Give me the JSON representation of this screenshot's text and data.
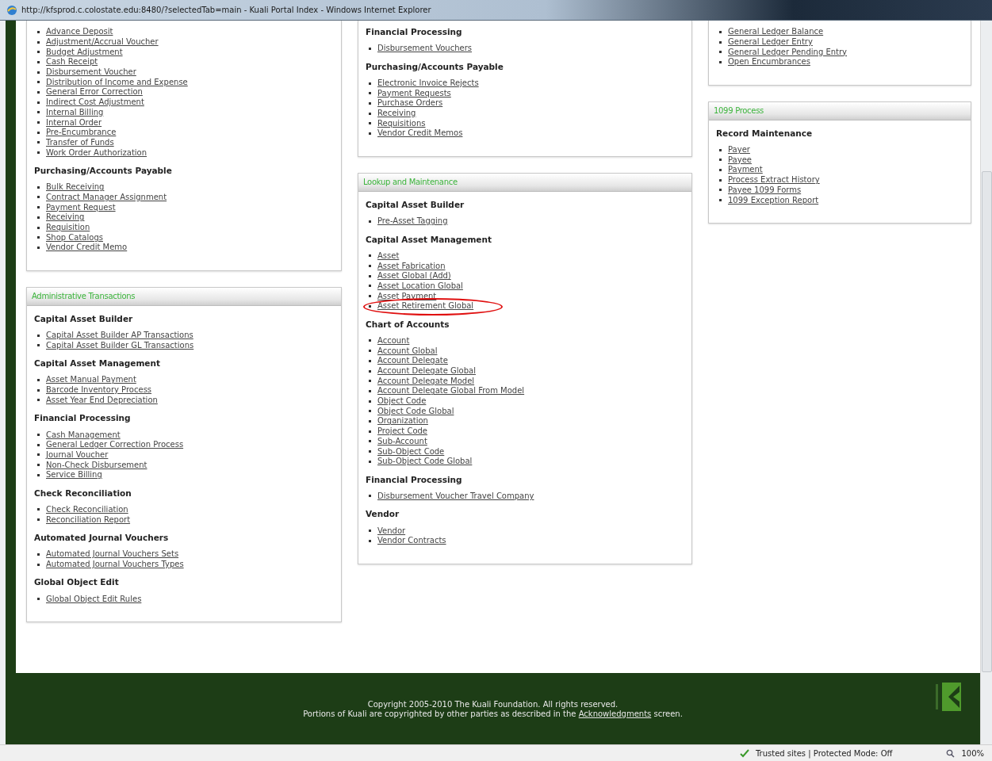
{
  "window": {
    "title": "http://kfsprod.c.colostate.edu:8480/?selectedTab=main - Kuali Portal Index - Windows Internet Explorer"
  },
  "columns": [
    {
      "panels": [
        {
          "sections": [
            {
              "links": [
                {
                  "label": "Advance Deposit",
                  "circled": false
                },
                {
                  "label": "Adjustment/Accrual Voucher",
                  "circled": false
                },
                {
                  "label": "Budget Adjustment",
                  "circled": false
                },
                {
                  "label": "Cash Receipt",
                  "circled": false
                },
                {
                  "label": "Disbursement Voucher",
                  "circled": false
                },
                {
                  "label": "Distribution of Income and Expense",
                  "circled": false
                },
                {
                  "label": "General Error Correction",
                  "circled": false
                },
                {
                  "label": "Indirect Cost Adjustment",
                  "circled": false
                },
                {
                  "label": "Internal Billing",
                  "circled": false
                },
                {
                  "label": "Internal Order",
                  "circled": false
                },
                {
                  "label": "Pre-Encumbrance",
                  "circled": false
                },
                {
                  "label": "Transfer of Funds",
                  "circled": false
                },
                {
                  "label": "Work Order Authorization",
                  "circled": false
                }
              ]
            },
            {
              "heading": "Purchasing/Accounts Payable",
              "links": [
                {
                  "label": "Bulk Receiving",
                  "circled": false
                },
                {
                  "label": "Contract Manager Assignment",
                  "circled": false
                },
                {
                  "label": "Payment Request",
                  "circled": false
                },
                {
                  "label": "Receiving",
                  "circled": false
                },
                {
                  "label": "Requisition",
                  "circled": false
                },
                {
                  "label": "Shop Catalogs",
                  "circled": false
                },
                {
                  "label": "Vendor Credit Memo",
                  "circled": false
                }
              ]
            }
          ]
        },
        {
          "title": "Administrative Transactions",
          "sections": [
            {
              "heading": "Capital Asset Builder",
              "links": [
                {
                  "label": "Capital Asset Builder AP Transactions",
                  "circled": false
                },
                {
                  "label": "Capital Asset Builder GL Transactions",
                  "circled": false
                }
              ]
            },
            {
              "heading": "Capital Asset Management",
              "links": [
                {
                  "label": "Asset Manual Payment",
                  "circled": false
                },
                {
                  "label": "Barcode Inventory Process",
                  "circled": false
                },
                {
                  "label": "Asset Year End Depreciation",
                  "circled": false
                }
              ]
            },
            {
              "heading": "Financial Processing",
              "links": [
                {
                  "label": "Cash Management",
                  "circled": false
                },
                {
                  "label": "General Ledger Correction Process",
                  "circled": false
                },
                {
                  "label": "Journal Voucher",
                  "circled": false
                },
                {
                  "label": "Non-Check Disbursement",
                  "circled": false
                },
                {
                  "label": "Service Billing",
                  "circled": false
                }
              ]
            },
            {
              "heading": "Check Reconciliation",
              "links": [
                {
                  "label": "Check Reconciliation",
                  "circled": false
                },
                {
                  "label": "Reconciliation Report",
                  "circled": false
                }
              ]
            },
            {
              "heading": "Automated Journal Vouchers",
              "links": [
                {
                  "label": "Automated Journal Vouchers Sets",
                  "circled": false
                },
                {
                  "label": "Automated Journal Vouchers Types",
                  "circled": false
                }
              ]
            },
            {
              "heading": "Global Object Edit",
              "links": [
                {
                  "label": "Global Object Edit Rules",
                  "circled": false
                }
              ]
            }
          ]
        }
      ]
    },
    {
      "panels": [
        {
          "sections": [
            {
              "heading": "Financial Processing",
              "links": [
                {
                  "label": "Disbursement Vouchers",
                  "circled": false
                }
              ]
            },
            {
              "heading": "Purchasing/Accounts Payable",
              "links": [
                {
                  "label": "Electronic Invoice Rejects",
                  "circled": false
                },
                {
                  "label": "Payment Requests",
                  "circled": false
                },
                {
                  "label": "Purchase Orders",
                  "circled": false
                },
                {
                  "label": "Receiving",
                  "circled": false
                },
                {
                  "label": "Requisitions",
                  "circled": false
                },
                {
                  "label": "Vendor Credit Memos",
                  "circled": false
                }
              ]
            }
          ]
        },
        {
          "title": "Lookup and Maintenance",
          "sections": [
            {
              "heading": "Capital Asset Builder",
              "links": [
                {
                  "label": "Pre-Asset Tagging",
                  "circled": false
                }
              ]
            },
            {
              "heading": "Capital Asset Management",
              "links": [
                {
                  "label": "Asset",
                  "circled": false
                },
                {
                  "label": "Asset Fabrication",
                  "circled": false
                },
                {
                  "label": "Asset Global (Add)",
                  "circled": false
                },
                {
                  "label": "Asset Location Global",
                  "circled": false
                },
                {
                  "label": "Asset Payment",
                  "circled": false
                },
                {
                  "label": "Asset Retirement Global",
                  "circled": true
                }
              ]
            },
            {
              "heading": "Chart of Accounts",
              "links": [
                {
                  "label": "Account",
                  "circled": false
                },
                {
                  "label": "Account Global",
                  "circled": false
                },
                {
                  "label": "Account Delegate",
                  "circled": false
                },
                {
                  "label": "Account Delegate Global",
                  "circled": false
                },
                {
                  "label": "Account Delegate Model",
                  "circled": false
                },
                {
                  "label": "Account Delegate Global From Model",
                  "circled": false
                },
                {
                  "label": "Object Code",
                  "circled": false
                },
                {
                  "label": "Object Code Global",
                  "circled": false
                },
                {
                  "label": "Organization",
                  "circled": false
                },
                {
                  "label": "Project Code",
                  "circled": false
                },
                {
                  "label": "Sub-Account",
                  "circled": false
                },
                {
                  "label": "Sub-Object Code",
                  "circled": false
                },
                {
                  "label": "Sub-Object Code Global",
                  "circled": false
                }
              ]
            },
            {
              "heading": "Financial Processing",
              "links": [
                {
                  "label": "Disbursement Voucher Travel Company",
                  "circled": false
                }
              ]
            },
            {
              "heading": "Vendor",
              "links": [
                {
                  "label": "Vendor",
                  "circled": false
                },
                {
                  "label": "Vendor Contracts",
                  "circled": false
                }
              ]
            }
          ]
        }
      ]
    },
    {
      "panels": [
        {
          "sections": [
            {
              "links": [
                {
                  "label": "General Ledger Balance",
                  "circled": false
                },
                {
                  "label": "General Ledger Entry",
                  "circled": false
                },
                {
                  "label": "General Ledger Pending Entry",
                  "circled": false
                },
                {
                  "label": "Open Encumbrances",
                  "circled": false
                }
              ]
            }
          ]
        },
        {
          "title": "1099 Process",
          "sections": [
            {
              "heading": "Record Maintenance",
              "links": [
                {
                  "label": "Payer",
                  "circled": false
                },
                {
                  "label": "Payee",
                  "circled": false
                },
                {
                  "label": "Payment",
                  "circled": false
                },
                {
                  "label": "Process Extract History",
                  "circled": false
                },
                {
                  "label": "Payee 1099 Forms",
                  "circled": false
                },
                {
                  "label": "1099 Exception Report",
                  "circled": false
                }
              ]
            }
          ]
        }
      ]
    }
  ],
  "footer": {
    "copyright": "Copyright 2005-2010 The Kuali Foundation. All rights reserved.",
    "notice_before": "Portions of Kuali are copyrighted by other parties as described in the ",
    "notice_link": "Acknowledgments",
    "notice_after": " screen."
  },
  "status_bar": {
    "zone": "Trusted sites | Protected Mode: Off",
    "zoom": "100%"
  }
}
